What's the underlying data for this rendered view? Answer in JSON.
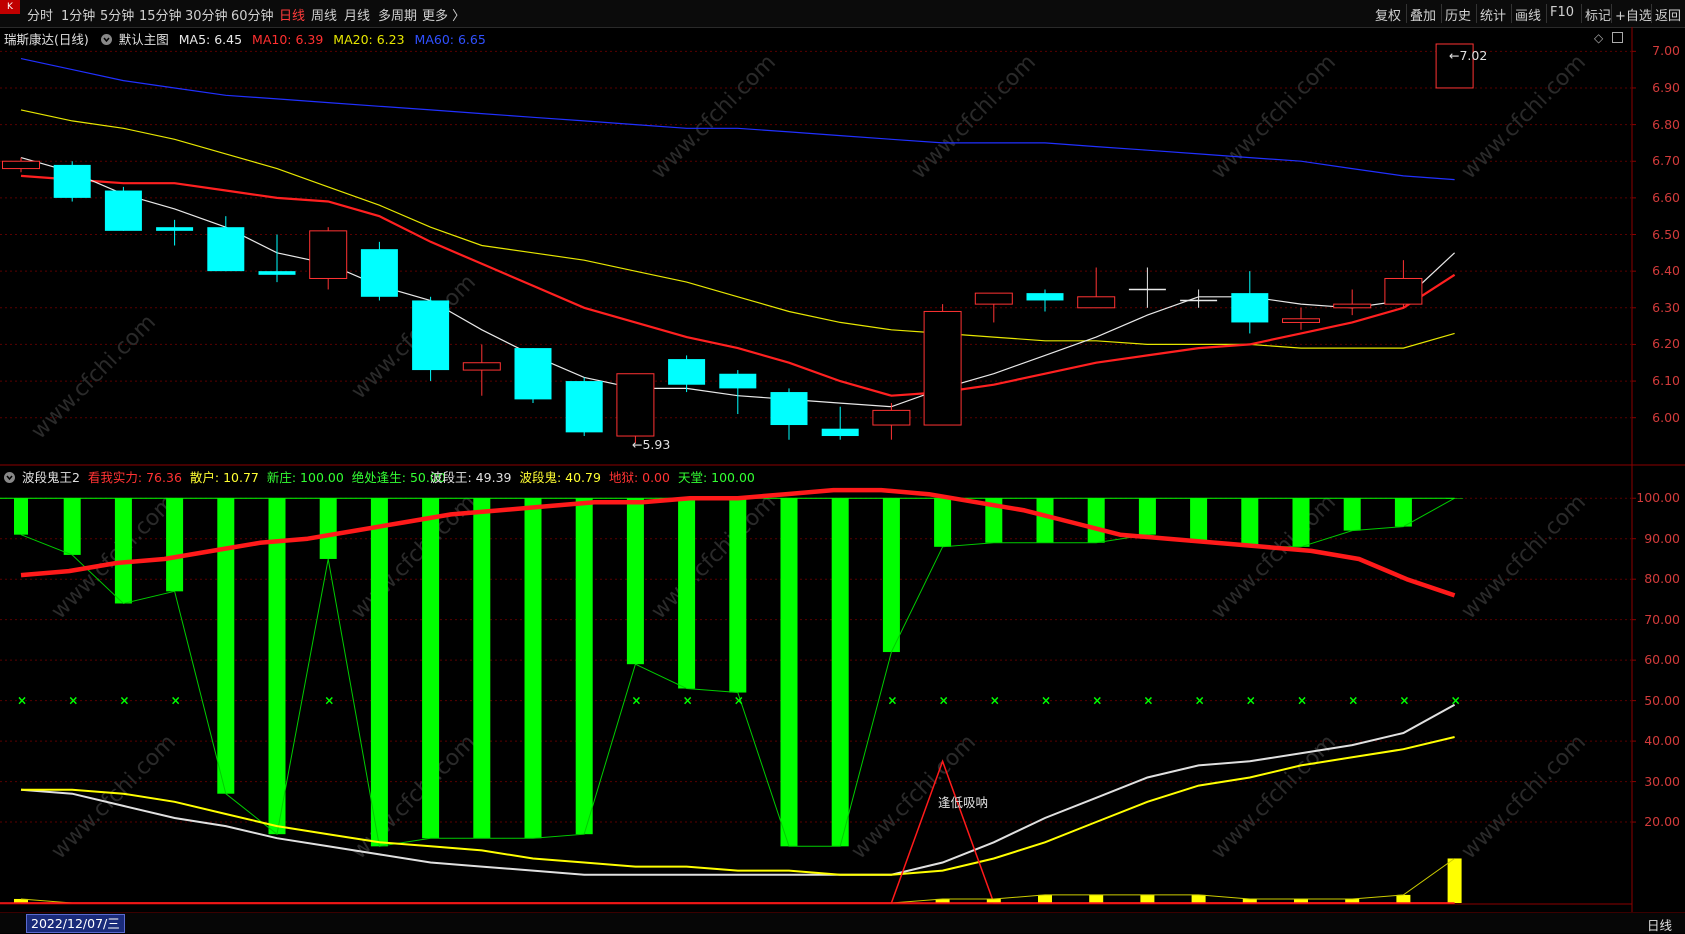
{
  "toolbar": {
    "logo_text": "K",
    "periods": [
      "分时",
      "1分钟",
      "5分钟",
      "15分钟",
      "30分钟",
      "60分钟",
      "日线",
      "周线",
      "月线",
      "多周期",
      "更多 〉"
    ],
    "active_period": "日线",
    "right_items": [
      "复权",
      "叠加",
      "历史",
      "统计",
      "画线",
      "F10",
      "标记",
      "+自选",
      "返回"
    ]
  },
  "main_chart": {
    "stock_name": "瑞斯康达(日线)",
    "template_label": "默认主图",
    "ma5_label": "MA5: 6.45",
    "ma10_label": "MA10: 6.39",
    "ma20_label": "MA20: 6.23",
    "ma60_label": "MA60: 6.65",
    "high_marker": "7.02",
    "low_marker": "5.93",
    "y_ticks": [
      "7.00",
      "6.90",
      "6.80",
      "6.70",
      "6.60",
      "6.50",
      "6.40",
      "6.30",
      "6.20",
      "6.10",
      "6.00"
    ],
    "colors": {
      "up": "#ff3333",
      "down": "#00ffff",
      "ma5": "#e8e8e8",
      "ma10": "#ff2020",
      "ma20": "#e6e600",
      "ma60": "#2030ff"
    }
  },
  "indicator": {
    "name": "波段鬼王2",
    "fields": [
      {
        "label": "看我实力: 76.36",
        "color": "#ff3333"
      },
      {
        "label": "散户: 10.77",
        "color": "#ffff33"
      },
      {
        "label": "新庄: 100.00",
        "color": "#33ff33"
      },
      {
        "label": "绝处逢生: 50.00",
        "color": "#33ff33"
      },
      {
        "label": "波段王: 49.39",
        "color": "#e0e0e0"
      },
      {
        "label": "波段鬼: 40.79",
        "color": "#ffff33"
      },
      {
        "label": "地狱: 0.00",
        "color": "#ff3333"
      },
      {
        "label": "天堂: 100.00",
        "color": "#33ff33"
      }
    ],
    "annotation": "逢低吸呐",
    "y_ticks": [
      "100.00",
      "90.00",
      "80.00",
      "70.00",
      "60.00",
      "50.00",
      "40.00",
      "30.00",
      "20.00"
    ]
  },
  "bottom": {
    "date": "2022/12/07/三",
    "period": "日线"
  },
  "watermark": "www.cfchi.com",
  "chart_data": [
    {
      "type": "candlestick",
      "title": "瑞斯康达(日线)",
      "ylim": [
        5.86,
        7.05
      ],
      "candles": [
        {
          "o": 6.68,
          "c": 6.7,
          "h": 6.71,
          "l": 6.67
        },
        {
          "o": 6.69,
          "c": 6.6,
          "h": 6.7,
          "l": 6.59
        },
        {
          "o": 6.62,
          "c": 6.51,
          "h": 6.63,
          "l": 6.51
        },
        {
          "o": 6.52,
          "c": 6.51,
          "h": 6.54,
          "l": 6.47
        },
        {
          "o": 6.52,
          "c": 6.4,
          "h": 6.55,
          "l": 6.4
        },
        {
          "o": 6.4,
          "c": 6.39,
          "h": 6.5,
          "l": 6.37
        },
        {
          "o": 6.38,
          "c": 6.51,
          "h": 6.52,
          "l": 6.35
        },
        {
          "o": 6.46,
          "c": 6.33,
          "h": 6.48,
          "l": 6.32
        },
        {
          "o": 6.32,
          "c": 6.13,
          "h": 6.33,
          "l": 6.1
        },
        {
          "o": 6.13,
          "c": 6.15,
          "h": 6.2,
          "l": 6.06
        },
        {
          "o": 6.19,
          "c": 6.05,
          "h": 6.19,
          "l": 6.04
        },
        {
          "o": 6.1,
          "c": 5.96,
          "h": 6.11,
          "l": 5.95
        },
        {
          "o": 5.95,
          "c": 6.12,
          "h": 6.12,
          "l": 5.93
        },
        {
          "o": 6.16,
          "c": 6.09,
          "h": 6.17,
          "l": 6.07
        },
        {
          "o": 6.12,
          "c": 6.08,
          "h": 6.13,
          "l": 6.01
        },
        {
          "o": 6.07,
          "c": 5.98,
          "h": 6.08,
          "l": 5.94
        },
        {
          "o": 5.97,
          "c": 5.95,
          "h": 6.03,
          "l": 5.94
        },
        {
          "o": 5.98,
          "c": 6.02,
          "h": 6.04,
          "l": 5.94
        },
        {
          "o": 5.98,
          "c": 6.29,
          "h": 6.31,
          "l": 5.98
        },
        {
          "o": 6.31,
          "c": 6.34,
          "h": 6.34,
          "l": 6.26
        },
        {
          "o": 6.34,
          "c": 6.32,
          "h": 6.35,
          "l": 6.29
        },
        {
          "o": 6.3,
          "c": 6.33,
          "h": 6.41,
          "l": 6.3
        },
        {
          "o": 6.35,
          "c": 6.35,
          "h": 6.41,
          "l": 6.3
        },
        {
          "o": 6.32,
          "c": 6.32,
          "h": 6.35,
          "l": 6.3
        },
        {
          "o": 6.34,
          "c": 6.26,
          "h": 6.4,
          "l": 6.23
        },
        {
          "o": 6.26,
          "c": 6.27,
          "h": 6.3,
          "l": 6.24
        },
        {
          "o": 6.3,
          "c": 6.31,
          "h": 6.35,
          "l": 6.28
        },
        {
          "o": 6.31,
          "c": 6.38,
          "h": 6.43,
          "l": 6.3
        },
        {
          "o": 6.9,
          "c": 7.02,
          "h": 7.02,
          "l": 6.9
        }
      ],
      "ma5": [
        6.71,
        6.67,
        6.61,
        6.57,
        6.52,
        6.45,
        6.42,
        6.36,
        6.32,
        6.24,
        6.17,
        6.11,
        6.08,
        6.08,
        6.06,
        6.05,
        6.04,
        6.03,
        6.08,
        6.12,
        6.17,
        6.22,
        6.28,
        6.33,
        6.33,
        6.31,
        6.3,
        6.32,
        6.45
      ],
      "ma10": [
        6.66,
        6.65,
        6.64,
        6.64,
        6.62,
        6.6,
        6.59,
        6.55,
        6.48,
        6.42,
        6.36,
        6.3,
        6.26,
        6.22,
        6.19,
        6.15,
        6.1,
        6.06,
        6.07,
        6.09,
        6.12,
        6.15,
        6.17,
        6.19,
        6.2,
        6.23,
        6.26,
        6.3,
        6.39
      ],
      "ma20": [
        6.84,
        6.81,
        6.79,
        6.76,
        6.72,
        6.68,
        6.63,
        6.58,
        6.52,
        6.47,
        6.45,
        6.43,
        6.4,
        6.37,
        6.33,
        6.29,
        6.26,
        6.24,
        6.23,
        6.22,
        6.21,
        6.21,
        6.2,
        6.2,
        6.2,
        6.19,
        6.19,
        6.19,
        6.23
      ],
      "ma60": [
        6.98,
        6.95,
        6.92,
        6.9,
        6.88,
        6.87,
        6.86,
        6.85,
        6.84,
        6.83,
        6.82,
        6.81,
        6.8,
        6.79,
        6.79,
        6.78,
        6.77,
        6.76,
        6.75,
        6.75,
        6.75,
        6.74,
        6.73,
        6.72,
        6.71,
        6.7,
        6.68,
        6.66,
        6.65
      ]
    },
    {
      "type": "bar",
      "title": "波段鬼王2",
      "ylim": [
        0,
        105
      ],
      "series": [
        {
          "name": "新庄",
          "values": [
            91,
            86,
            74,
            77,
            27,
            17,
            85,
            14,
            16,
            16,
            16,
            17,
            59,
            53,
            52,
            14,
            14,
            62,
            88,
            89,
            89,
            89,
            91,
            89,
            88,
            88,
            92,
            93,
            100
          ]
        },
        {
          "name": "看我实力",
          "values": [
            81,
            82,
            84,
            85,
            87,
            89,
            90,
            92,
            94,
            96,
            97,
            98,
            99,
            99,
            100,
            100,
            101,
            102,
            102,
            101,
            99,
            97,
            94,
            91,
            90,
            89,
            88,
            87,
            85,
            80,
            76
          ]
        },
        {
          "name": "绝处逢生",
          "values": [
            50,
            50,
            50,
            50,
            0,
            0,
            50,
            0,
            0,
            0,
            0,
            0,
            50,
            50,
            50,
            0,
            0,
            50,
            50,
            50,
            50,
            50,
            50,
            50,
            50,
            50,
            50,
            50,
            50
          ]
        },
        {
          "name": "波段王",
          "values": [
            28,
            27,
            24,
            21,
            19,
            16,
            14,
            12,
            10,
            9,
            8,
            7,
            7,
            7,
            7,
            7,
            7,
            7,
            10,
            15,
            21,
            26,
            31,
            34,
            35,
            37,
            39,
            42,
            49
          ]
        },
        {
          "name": "波段鬼",
          "values": [
            28,
            28,
            27,
            25,
            22,
            19,
            17,
            15,
            14,
            13,
            11,
            10,
            9,
            9,
            8,
            8,
            7,
            7,
            8,
            11,
            15,
            20,
            25,
            29,
            31,
            34,
            36,
            38,
            41
          ]
        },
        {
          "name": "散户",
          "values": [
            1,
            0,
            0,
            0,
            0,
            0,
            0,
            0,
            0,
            0,
            0,
            0,
            0,
            0,
            0,
            0,
            0,
            0,
            1,
            1,
            2,
            2,
            2,
            2,
            1,
            1,
            1,
            2,
            11
          ]
        },
        {
          "name": "地狱",
          "values": [
            0,
            0,
            0,
            0,
            0,
            0,
            0,
            0,
            0,
            0,
            0,
            0,
            0,
            0,
            0,
            0,
            0,
            0,
            35,
            0,
            0,
            0,
            0,
            0,
            0,
            0,
            0,
            0,
            0
          ]
        },
        {
          "name": "天堂",
          "values": [
            100,
            100,
            100,
            100,
            100,
            100,
            100,
            100,
            100,
            100,
            100,
            100,
            100,
            100,
            100,
            100,
            100,
            100,
            100,
            100,
            100,
            100,
            100,
            100,
            100,
            100,
            100,
            100,
            100
          ]
        }
      ]
    }
  ]
}
